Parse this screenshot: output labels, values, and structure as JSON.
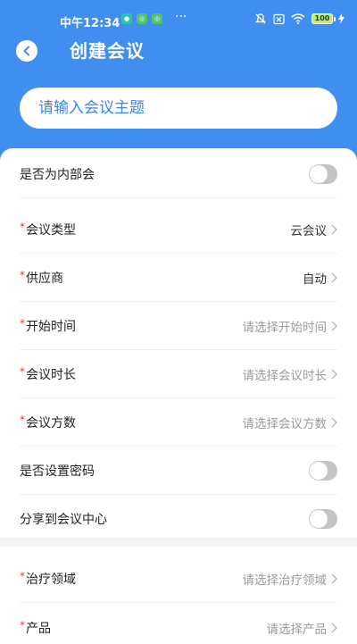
{
  "status_bar": {
    "time": "中午12:34",
    "dots": "···",
    "battery": "100"
  },
  "header": {
    "title": "创建会议"
  },
  "topic": {
    "placeholder": "请输入会议主题"
  },
  "form": {
    "internal": {
      "label": "是否为内部会",
      "enabled": false
    },
    "meeting_type": {
      "required_mark": "*",
      "label": "会议类型",
      "value": "云会议"
    },
    "supplier": {
      "required_mark": "*",
      "label": "供应商",
      "value": "自动"
    },
    "start_time": {
      "required_mark": "*",
      "label": "开始时间",
      "placeholder": "请选择开始时间"
    },
    "duration": {
      "required_mark": "*",
      "label": "会议时长",
      "placeholder": "请选择会议时长"
    },
    "parties": {
      "required_mark": "*",
      "label": "会议方数",
      "placeholder": "请选择会议方数"
    },
    "password": {
      "label": "是否设置密码",
      "enabled": false
    },
    "share": {
      "label": "分享到会议中心",
      "enabled": false
    }
  },
  "form2": {
    "therapy_area": {
      "required_mark": "*",
      "label": "治疗领域",
      "placeholder": "请选择治疗领域"
    },
    "product": {
      "required_mark": "*",
      "label": "产品",
      "placeholder": "请选择产品"
    }
  },
  "colors": {
    "accent": "#3f8ef0",
    "required": "#e53935",
    "placeholder": "#9a9a9a"
  }
}
